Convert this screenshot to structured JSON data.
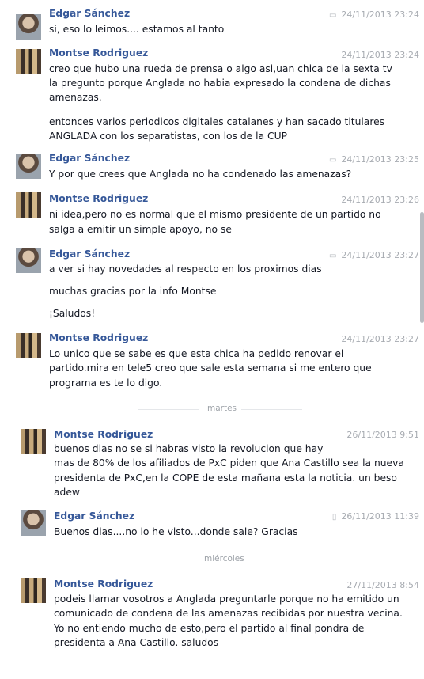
{
  "messages": [
    {
      "author": "Edgar Sánchez",
      "time": "24/11/2013 23:24",
      "icon": "chat-icon",
      "lines": [
        "si, eso lo leimos.... estamos al tanto"
      ]
    },
    {
      "author": "Montse Rodriguez",
      "time": "24/11/2013 23:24",
      "lines": [
        "creo que hubo una rueda de prensa o algo asi,uan chica de la sexta tv",
        "la pregunto porque Anglada no habia expresado la condena de dichas",
        "amenazas.",
        "entonces varios periodicos digitales catalanes y han sacado titulares",
        "ANGLADA con los separatistas, con los de la CUP"
      ]
    },
    {
      "author": "Edgar Sánchez",
      "time": "24/11/2013 23:25",
      "icon": "chat-icon",
      "lines": [
        "Y por que crees que Anglada no ha condenado las amenazas?"
      ]
    },
    {
      "author": "Montse Rodriguez",
      "time": "24/11/2013 23:26",
      "lines": [
        "ni idea,pero no es normal que el mismo presidente de un partido no",
        "salga a emitir un simple apoyo, no se"
      ]
    },
    {
      "author": "Edgar Sánchez",
      "time": "24/11/2013 23:27",
      "icon": "chat-icon",
      "lines": [
        "a ver si hay novedades al respecto en los proximos dias",
        "muchas gracias por la info Montse",
        "¡Saludos!"
      ]
    },
    {
      "author": "Montse Rodriguez",
      "time": "24/11/2013 23:27",
      "lines": [
        "Lo unico que se sabe es que esta chica ha pedido renovar el",
        "partido.mira en tele5 creo que sale esta semana si me entero que",
        "programa es te lo digo."
      ]
    },
    {
      "author": "Montse Rodriguez",
      "time": "26/11/2013 9:51",
      "lines": [
        "buenos dias  no se si habras visto la revolucion que hay",
        "mas de 80% de los afiliados de PxC piden que Ana Castillo sea la nueva",
        "presidenta de PxC,en la COPE de esta mañana esta la noticia. un beso",
        "adew"
      ]
    },
    {
      "author": "Edgar Sánchez",
      "time": "26/11/2013 11:39",
      "icon": "mobile-icon",
      "lines": [
        "Buenos dias....no lo he visto...donde sale? Gracias"
      ]
    },
    {
      "author": "Montse Rodriguez",
      "time": "27/11/2013 8:54",
      "lines": [
        "podeis llamar vosotros a Anglada preguntarle porque no ha emitido un",
        "comunicado de condena de las amenazas recibidas por nuestra vecina.",
        "Yo no entiendo mucho de esto,pero el partido al final pondra de",
        "presidenta a Ana Castillo.  saludos"
      ]
    }
  ],
  "dividers": [
    "martes",
    "miércoles"
  ]
}
